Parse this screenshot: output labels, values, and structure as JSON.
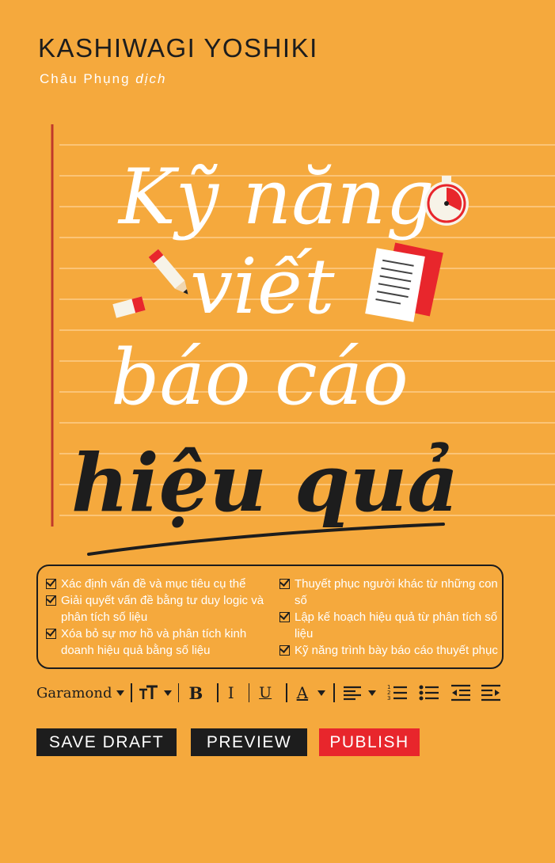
{
  "author": "KASHIWAGI YOSHIKI",
  "translator": {
    "name": "Châu Phụng",
    "role": "dịch"
  },
  "title": {
    "line1": "Kỹ năng",
    "line2": "viết",
    "line3": "báo cáo",
    "line4": "hiệu quả"
  },
  "features": {
    "left": [
      "Xác định vấn đề và mục tiêu cụ thể",
      "Giải quyết vấn đề bằng tư duy logic và phân tích số liệu",
      "Xóa bỏ sự mơ hồ và phân tích kinh doanh hiệu quả bằng số liệu"
    ],
    "right": [
      "Thuyết phục người khác từ những con số",
      "Lập kế hoạch hiệu quả từ phân tích số liệu",
      "Kỹ năng trình bày báo cáo thuyết phục"
    ]
  },
  "toolbar": {
    "font": "Garamond",
    "bold": "B",
    "italic": "I",
    "underline": "U",
    "text_color": "A"
  },
  "buttons": {
    "save_draft": "SAVE DRAFT",
    "preview": "PREVIEW",
    "publish": "PUBLISH"
  },
  "colors": {
    "background": "#f5a93d",
    "accent_red": "#e8262c",
    "dark": "#1d1d1d",
    "margin_line": "#c0392b"
  }
}
